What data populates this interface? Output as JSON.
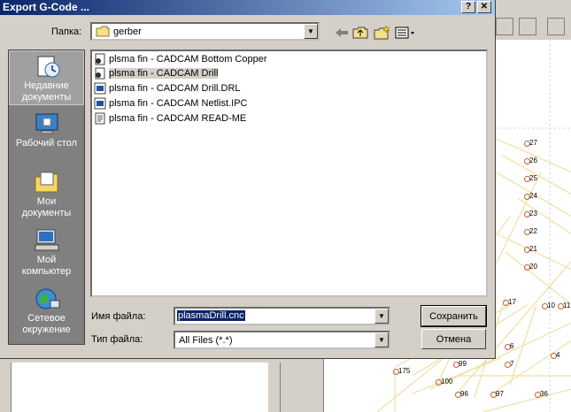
{
  "dialog": {
    "title": "Export G-Code ...",
    "help_btn": "?",
    "close_btn": "✕"
  },
  "lookin": {
    "label": "Папка:",
    "value": "gerber"
  },
  "places": [
    {
      "label1": "Недавние",
      "label2": "документы"
    },
    {
      "label1": "Рабочий стол",
      "label2": ""
    },
    {
      "label1": "Мои",
      "label2": "документы"
    },
    {
      "label1": "Мой",
      "label2": "компьютер"
    },
    {
      "label1": "Сетевое",
      "label2": "окружение"
    }
  ],
  "files": [
    {
      "name": "plsma fin - CADCAM Bottom Copper",
      "icon": "gerber-file-icon"
    },
    {
      "name": "plsma fin - CADCAM Drill",
      "icon": "gerber-file-icon"
    },
    {
      "name": "plsma fin - CADCAM Drill.DRL",
      "icon": "drl-file-icon"
    },
    {
      "name": "plsma fin - CADCAM Netlist.IPC",
      "icon": "ipc-file-icon"
    },
    {
      "name": "plsma fin - CADCAM READ-ME",
      "icon": "text-file-icon"
    }
  ],
  "filename": {
    "label": "Имя файла:",
    "value": "plasmaDrill.cnc"
  },
  "filetype": {
    "label": "Тип файла:",
    "value": "All Files (*.*)"
  },
  "buttons": {
    "save": "Сохранить",
    "cancel": "Отмена"
  },
  "canvas_labels": [
    "27",
    "26",
    "25",
    "24",
    "23",
    "22",
    "21",
    "20",
    "17",
    "10",
    "11",
    "6",
    "7",
    "4",
    "99",
    "175",
    "100",
    "96",
    "97",
    "36"
  ]
}
